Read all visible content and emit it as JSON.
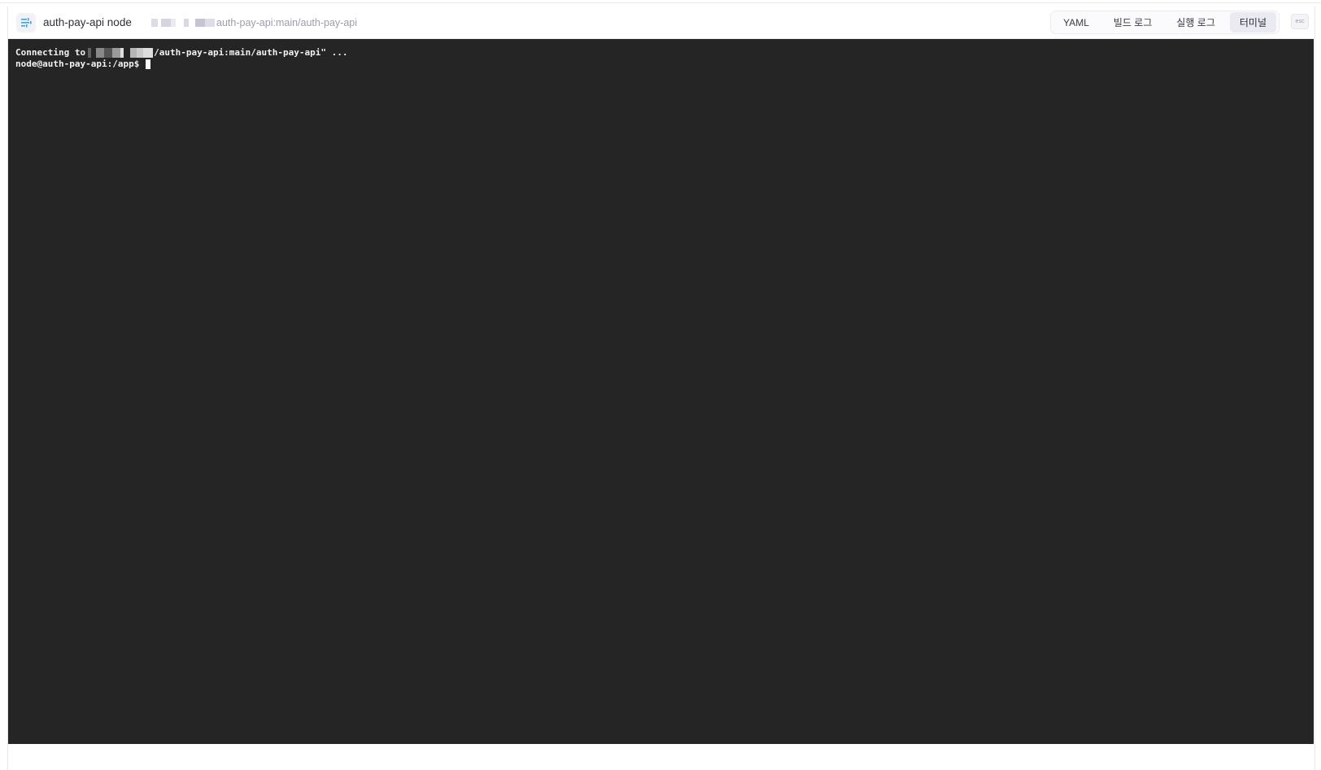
{
  "header": {
    "title": "auth-pay-api node",
    "path": "auth-pay-api:main/auth-pay-api",
    "app_icon": "sliders-icon"
  },
  "tabs": [
    {
      "label": "YAML",
      "active": false
    },
    {
      "label": "빌드 로그",
      "active": false
    },
    {
      "label": "실행 로그",
      "active": false
    },
    {
      "label": "터미널",
      "active": true
    }
  ],
  "esc_label": "esc",
  "terminal": {
    "connect_prefix": "Connecting to",
    "connect_suffix": "/auth-pay-api:main/auth-pay-api\" ...",
    "prompt": "node@auth-pay-api:/app$"
  },
  "colors": {
    "terminal_bg": "#252525",
    "terminal_text": "#f2f2f2",
    "accent_icon": "#3aa4e8"
  }
}
